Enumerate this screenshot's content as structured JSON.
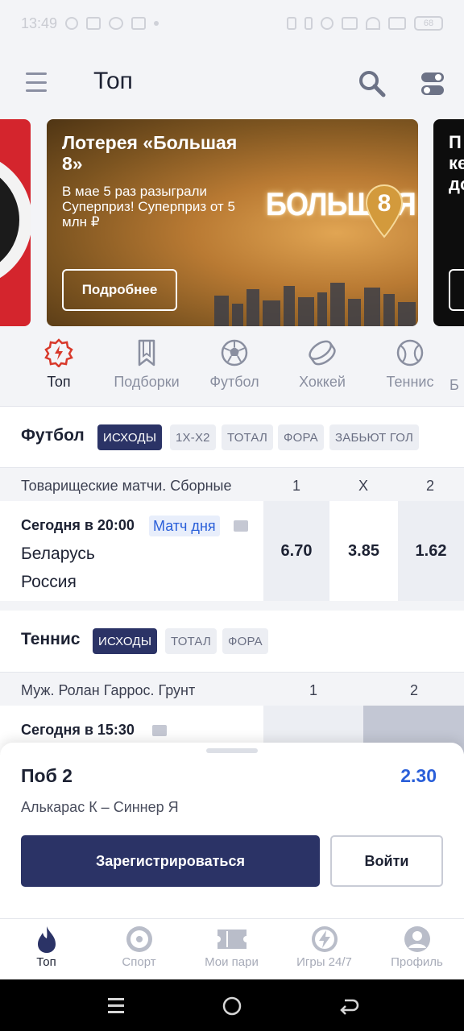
{
  "status_bar": {
    "time": "13:49",
    "battery": "68"
  },
  "header": {
    "title": "Топ"
  },
  "banners": {
    "main": {
      "title": "Лотерея «Большая 8»",
      "subtitle": "В мае 5 раз разыграли Суперприз! Суперприз от 5 млн ₽",
      "button": "Подробнее",
      "logo_text": "БОЛЬШАЯ",
      "logo_digit": "8"
    },
    "right_partial_text": "П\nке\nдо"
  },
  "categories": [
    {
      "label": "Топ",
      "icon": "top-badge-icon",
      "active": true
    },
    {
      "label": "Подборки",
      "icon": "bookmark-icon",
      "active": false
    },
    {
      "label": "Футбол",
      "icon": "soccer-ball-icon",
      "active": false
    },
    {
      "label": "Хоккей",
      "icon": "hockey-puck-icon",
      "active": false
    },
    {
      "label": "Теннис",
      "icon": "tennis-ball-icon",
      "active": false
    },
    {
      "label": "Б",
      "icon": "next-category-icon",
      "active": false
    }
  ],
  "football": {
    "title": "Футбол",
    "chips": [
      "ИСХОДЫ",
      "1Х-Х2",
      "ТОТАЛ",
      "ФОРА",
      "ЗАБЬЮТ ГОЛ"
    ],
    "league": "Товарищеские матчи. Сборные",
    "columns": [
      "1",
      "X",
      "2"
    ],
    "match": {
      "time": "Сегодня в 20:00",
      "badge": "Матч дня",
      "team1": "Беларусь",
      "team2": "Россия",
      "odds": [
        "6.70",
        "3.85",
        "1.62"
      ]
    }
  },
  "tennis": {
    "title": "Теннис",
    "chips": [
      "ИСХОДЫ",
      "ТОТАЛ",
      "ФОРА"
    ],
    "league": "Муж. Ролан Гаррос. Грунт",
    "columns": [
      "1",
      "2"
    ],
    "match": {
      "time": "Сегодня в 15:30"
    }
  },
  "bet_sheet": {
    "outcome": "Поб 2",
    "odd": "2.30",
    "match": "Алькарас К – Синнер Я",
    "register": "Зарегистрироваться",
    "login": "Войти"
  },
  "bottom_nav": [
    {
      "label": "Топ",
      "icon": "flame-icon",
      "active": true
    },
    {
      "label": "Спорт",
      "icon": "sport-target-icon",
      "active": false
    },
    {
      "label": "Мои пари",
      "icon": "ticket-icon",
      "active": false
    },
    {
      "label": "Игры 24/7",
      "icon": "lightning-icon",
      "active": false
    },
    {
      "label": "Профиль",
      "icon": "profile-icon",
      "active": false
    }
  ],
  "colors": {
    "accent": "#2b3366",
    "odd_blue": "#2a5fd9",
    "top_red": "#d8392b"
  }
}
